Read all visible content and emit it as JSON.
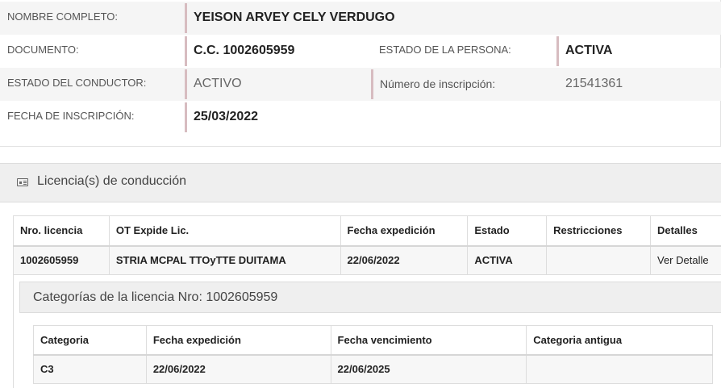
{
  "persona": {
    "nombre_label": "NOMBRE COMPLETO:",
    "nombre": "YEISON ARVEY CELY VERDUGO",
    "documento_label": "DOCUMENTO:",
    "documento": "C.C. 1002605959",
    "estado_persona_label": "ESTADO DE LA PERSONA:",
    "estado_persona": "ACTIVA",
    "estado_conductor_label": "ESTADO DEL CONDUCTOR:",
    "estado_conductor": "ACTIVO",
    "inscripcion_label": "Número de inscripción:",
    "inscripcion": "21541361",
    "fecha_label": "FECHA DE INSCRIPCIÓN:",
    "fecha": "25/03/2022"
  },
  "licencias": {
    "title": "Licencia(s) de conducción",
    "columns": [
      "Nro. licencia",
      "OT Expide Lic.",
      "Fecha expedición",
      "Estado",
      "Restricciones",
      "Detalles"
    ],
    "rows": [
      {
        "nro": "1002605959",
        "ot": "STRIA MCPAL TTOyTTE DUITAMA",
        "fecha": "22/06/2022",
        "estado": "ACTIVA",
        "restricciones": "",
        "detalles": "Ver Detalle"
      }
    ]
  },
  "categorias": {
    "title": "Categorías de la licencia Nro: 1002605959",
    "columns": [
      "Categoria",
      "Fecha expedición",
      "Fecha vencimiento",
      "Categoria antigua"
    ],
    "rows": [
      {
        "categoria": "C3",
        "expedicion": "22/06/2022",
        "vencimiento": "22/06/2025",
        "antigua": ""
      }
    ]
  },
  "colors": {
    "accent_bar": "#d7bcc0",
    "row_shade": "#f5f5f5",
    "panel_bg": "#efefef"
  }
}
